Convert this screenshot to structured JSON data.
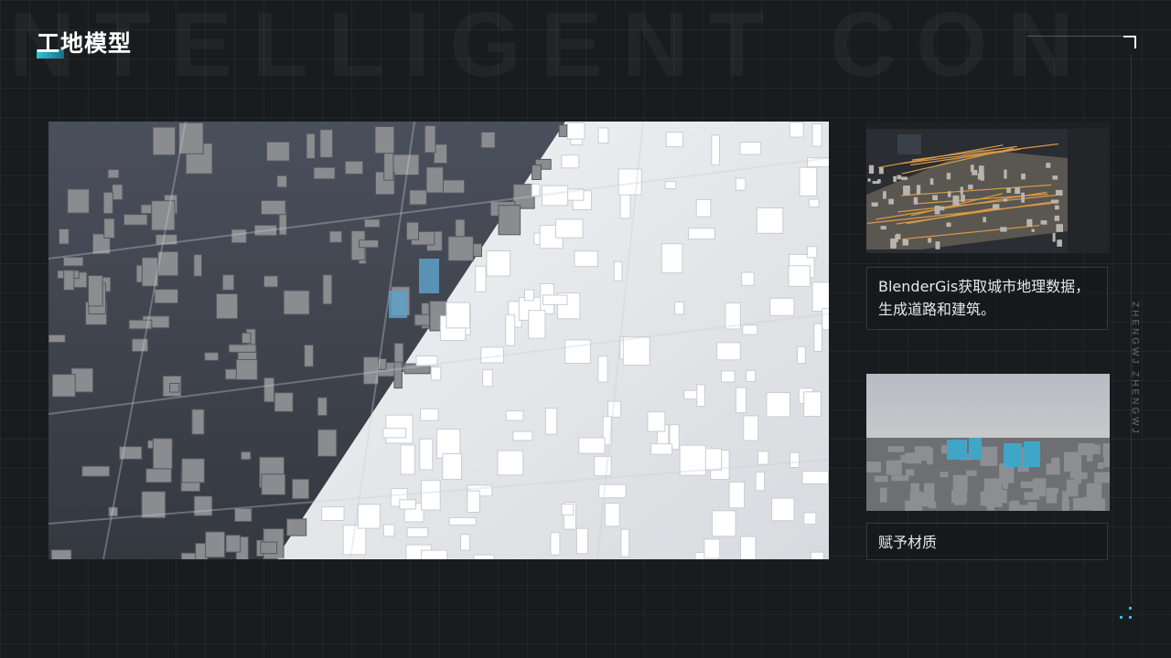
{
  "watermark_text": "INTELLIGENT CON",
  "page_title": "工地模型",
  "vertical_text": "ZHENGWJ ZHENGWJ",
  "captions": [
    {
      "line1": "BlenderGis获取城市地理数据，",
      "line2": "生成道路和建筑。"
    },
    {
      "line1": "赋予材质",
      "line2": ""
    }
  ],
  "colors": {
    "background": "#181c1f",
    "accent": "#2ec3d6",
    "dark_city": "#3d414a",
    "light_city": "#e9eaed"
  },
  "icons": [
    "corner-bracket-icon",
    "dots-icon"
  ]
}
